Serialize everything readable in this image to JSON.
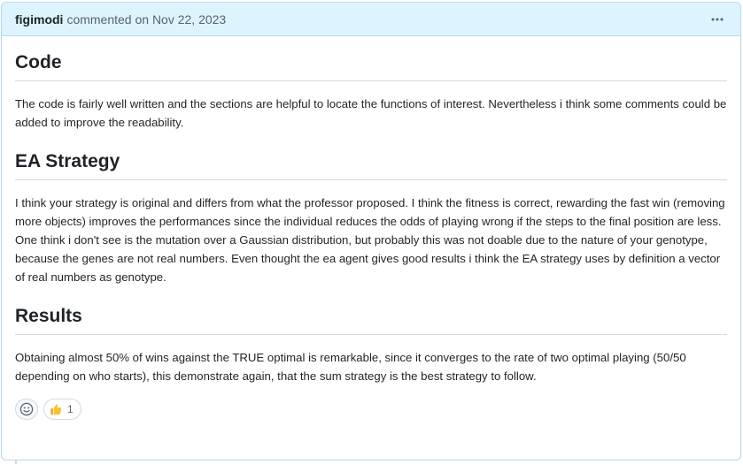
{
  "comment": {
    "author": "figimodi",
    "action": "commented on",
    "date": "Nov 22, 2023",
    "sections": [
      {
        "heading": "Code",
        "paragraphs": [
          "The code is fairly well written and the sections are helpful to locate the functions of interest. Nevertheless i think some comments could be added to improve the readability."
        ]
      },
      {
        "heading": "EA Strategy",
        "paragraphs": [
          "I think your strategy is original and differs from what the professor proposed. I think the fitness is correct, rewarding the fast win (removing more objects) improves the performances since the individual reduces the odds of playing wrong if the steps to the final position are less.",
          "One think i don't see is the mutation over a Gaussian distribution, but probably this was not doable due to the nature of your genotype, because the genes are not real numbers. Even thought the ea agent gives good results i think the EA strategy uses by definition a vector of real numbers as genotype."
        ]
      },
      {
        "heading": "Results",
        "paragraphs": [
          "Obtaining almost 50% of wins against the TRUE optimal is remarkable, since it converges to the rate of two optimal playing (50/50 depending on who starts), this demonstrate again, that the sum strategy is the best strategy to follow."
        ]
      }
    ],
    "reactions": {
      "add_icon": "smiley-icon",
      "items": [
        {
          "icon": "thumbs-up-icon",
          "count": "1"
        }
      ]
    }
  },
  "colors": {
    "header_bg": "#ddf4ff",
    "border": "#b6d7f5",
    "muted_text": "#59636e"
  }
}
